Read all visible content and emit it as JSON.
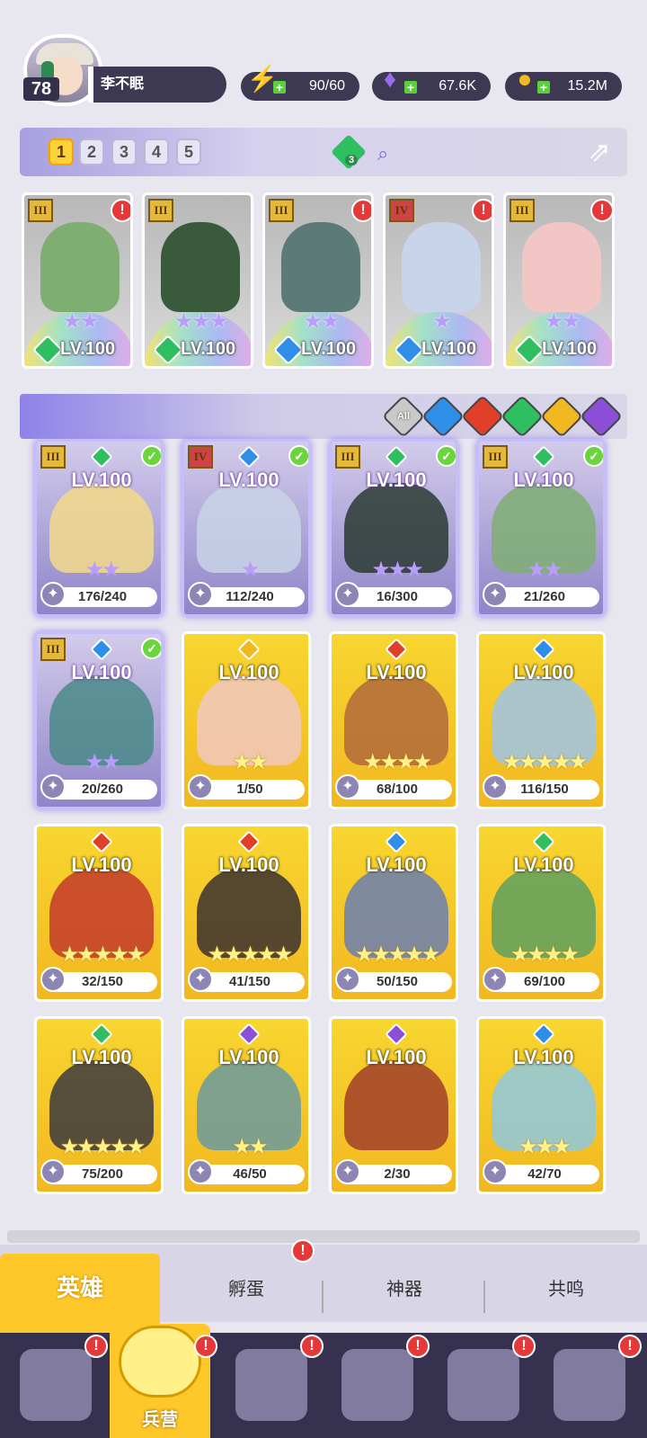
{
  "player": {
    "level": "78",
    "name": "李不眠"
  },
  "resources": [
    {
      "name": "energy",
      "icon": "lightning-icon",
      "value": "90/60",
      "color": "#5ad13b"
    },
    {
      "name": "gems",
      "icon": "diamond-icon",
      "value": "67.6K",
      "color": "#9a6bf0"
    },
    {
      "name": "gold",
      "icon": "coin-icon",
      "value": "15.2M",
      "color": "#f2b821"
    }
  ],
  "team_slots": [
    "1",
    "2",
    "3",
    "4",
    "5"
  ],
  "active_slot": "1",
  "team_gem_count": "3",
  "team": [
    {
      "rank": "III",
      "level": "LV.100",
      "stars": "★★",
      "element": "earth",
      "alert": "!"
    },
    {
      "rank": "III",
      "level": "LV.100",
      "stars": "★★★",
      "element": "earth",
      "alert": ""
    },
    {
      "rank": "III",
      "level": "LV.100",
      "stars": "★★",
      "element": "water",
      "alert": "!"
    },
    {
      "rank": "IV",
      "level": "LV.100",
      "stars": "★",
      "element": "water",
      "alert": "!"
    },
    {
      "rank": "III",
      "level": "LV.100",
      "stars": "★★",
      "element": "earth",
      "alert": "!"
    }
  ],
  "filters": [
    {
      "label": "All",
      "icon": "all-filter-icon",
      "color": "#c9c9c9"
    },
    {
      "label": "",
      "icon": "water-element-icon",
      "color": "#2f8fe8"
    },
    {
      "label": "",
      "icon": "fire-element-icon",
      "color": "#e0402a"
    },
    {
      "label": "",
      "icon": "earth-element-icon",
      "color": "#2fbf61"
    },
    {
      "label": "",
      "icon": "light-element-icon",
      "color": "#f2b821"
    },
    {
      "label": "",
      "icon": "dark-element-icon",
      "color": "#8b4fd8"
    }
  ],
  "heroes": [
    {
      "level": "LV.100",
      "count": "176/240",
      "stars": "★★",
      "rank": "III",
      "element": "earth",
      "in_team": true
    },
    {
      "level": "LV.100",
      "count": "112/240",
      "stars": "★",
      "rank": "IV",
      "element": "water",
      "in_team": true
    },
    {
      "level": "LV.100",
      "count": "16/300",
      "stars": "★★★",
      "rank": "III",
      "element": "earth",
      "in_team": true
    },
    {
      "level": "LV.100",
      "count": "21/260",
      "stars": "★★",
      "rank": "III",
      "element": "earth",
      "in_team": true
    },
    {
      "level": "LV.100",
      "count": "20/260",
      "stars": "★★",
      "rank": "III",
      "element": "water",
      "in_team": true
    },
    {
      "level": "LV.100",
      "count": "1/50",
      "stars": "★★",
      "rank": "",
      "element": "light",
      "in_team": false
    },
    {
      "level": "LV.100",
      "count": "68/100",
      "stars": "★★★★",
      "rank": "",
      "element": "fire",
      "in_team": false
    },
    {
      "level": "LV.100",
      "count": "116/150",
      "stars": "★★★★★",
      "rank": "",
      "element": "water",
      "in_team": false
    },
    {
      "level": "LV.100",
      "count": "32/150",
      "stars": "★★★★★",
      "rank": "",
      "element": "fire",
      "in_team": false
    },
    {
      "level": "LV.100",
      "count": "41/150",
      "stars": "★★★★★",
      "rank": "",
      "element": "fire",
      "in_team": false
    },
    {
      "level": "LV.100",
      "count": "50/150",
      "stars": "★★★★★",
      "rank": "",
      "element": "water",
      "in_team": false
    },
    {
      "level": "LV.100",
      "count": "69/100",
      "stars": "★★★★",
      "rank": "",
      "element": "earth",
      "in_team": false
    },
    {
      "level": "LV.100",
      "count": "75/200",
      "stars": "★★★★★",
      "rank": "",
      "element": "earth",
      "in_team": false
    },
    {
      "level": "LV.100",
      "count": "46/50",
      "stars": "★★",
      "rank": "",
      "element": "dark",
      "in_team": false
    },
    {
      "level": "LV.100",
      "count": "2/30",
      "stars": "",
      "rank": "",
      "element": "dark",
      "in_team": false
    },
    {
      "level": "LV.100",
      "count": "42/70",
      "stars": "★★★",
      "rank": "",
      "element": "water",
      "in_team": false
    }
  ],
  "tabs": {
    "hero": "英雄",
    "hatch": "孵蛋",
    "artifact": "神器",
    "resonance": "共鸣"
  },
  "nav": {
    "barracks": "兵营"
  }
}
